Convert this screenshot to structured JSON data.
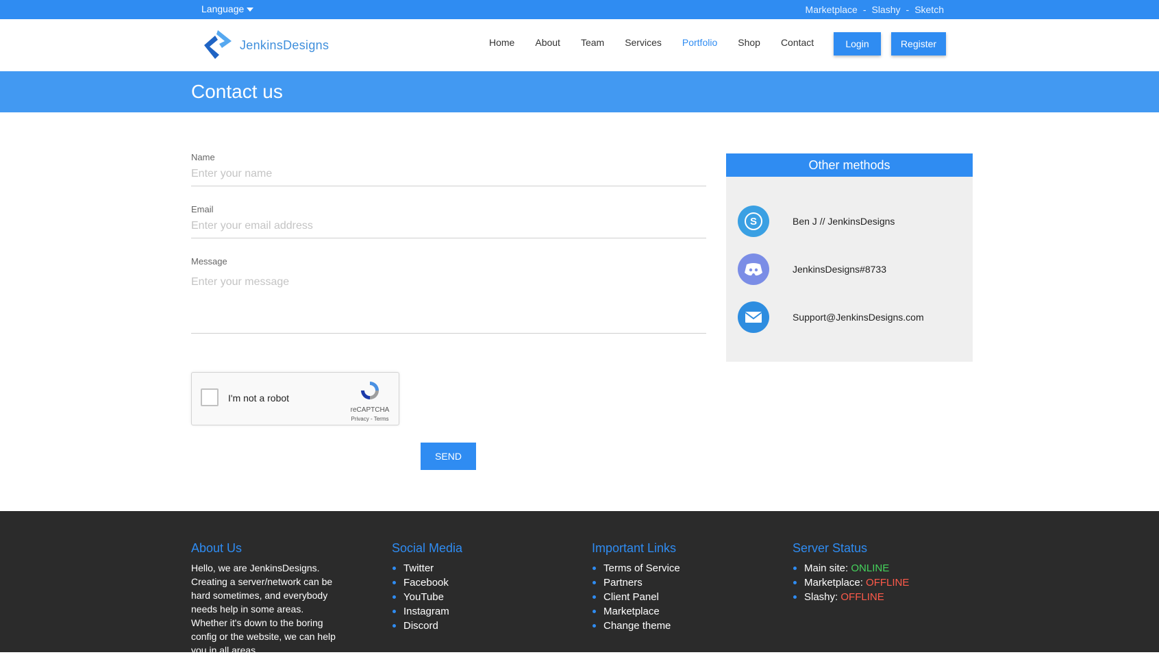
{
  "topbar": {
    "language_label": "Language",
    "links": [
      "Marketplace",
      "Slashy",
      "Sketch"
    ],
    "separator": "-"
  },
  "header": {
    "logo_text": "JenkinsDesigns",
    "nav": [
      {
        "label": "Home",
        "active": false
      },
      {
        "label": "About",
        "active": false
      },
      {
        "label": "Team",
        "active": false
      },
      {
        "label": "Services",
        "active": false
      },
      {
        "label": "Portfolio",
        "active": true
      },
      {
        "label": "Shop",
        "active": false
      },
      {
        "label": "Contact",
        "active": false
      }
    ],
    "login_label": "Login",
    "register_label": "Register"
  },
  "banner": {
    "title": "Contact us"
  },
  "form": {
    "name_label": "Name",
    "name_placeholder": "Enter your name",
    "email_label": "Email",
    "email_placeholder": "Enter your email address",
    "message_label": "Message",
    "message_placeholder": "Enter your message",
    "send_label": "SEND"
  },
  "recaptcha": {
    "label": "I'm not a robot",
    "brand": "reCAPTCHA",
    "terms": "Privacy - Terms"
  },
  "methods": {
    "title": "Other methods",
    "items": [
      {
        "icon": "skype-icon",
        "text": "Ben J // JenkinsDesigns",
        "color": "#3aa0e3"
      },
      {
        "icon": "discord-icon",
        "text": "JenkinsDesigns#8733",
        "color": "#7b8de6"
      },
      {
        "icon": "mail-icon",
        "text": "Support@JenkinsDesigns.com",
        "color": "#2e8de0"
      }
    ]
  },
  "footer": {
    "about": {
      "title": "About Us",
      "text": "Hello, we are JenkinsDesigns. Creating a server/network can be hard sometimes, and everybody needs help in some areas. Whether it's down to the boring config or the website, we can help you in all areas."
    },
    "social": {
      "title": "Social Media",
      "items": [
        "Twitter",
        "Facebook",
        "YouTube",
        "Instagram",
        "Discord"
      ]
    },
    "links": {
      "title": "Important Links",
      "items": [
        "Terms of Service",
        "Partners",
        "Client Panel",
        "Marketplace",
        "Change theme"
      ]
    },
    "status": {
      "title": "Server Status",
      "items": [
        {
          "name": "Main site:",
          "state": "ONLINE"
        },
        {
          "name": "Marketplace:",
          "state": "OFFLINE"
        },
        {
          "name": "Slashy:",
          "state": "OFFLINE"
        }
      ]
    }
  },
  "colors": {
    "primary": "#2f8cf2",
    "banner": "#4299f2",
    "footer_bg": "#2b2b2b",
    "online": "#45d45c",
    "offline": "#ff5a4a"
  }
}
